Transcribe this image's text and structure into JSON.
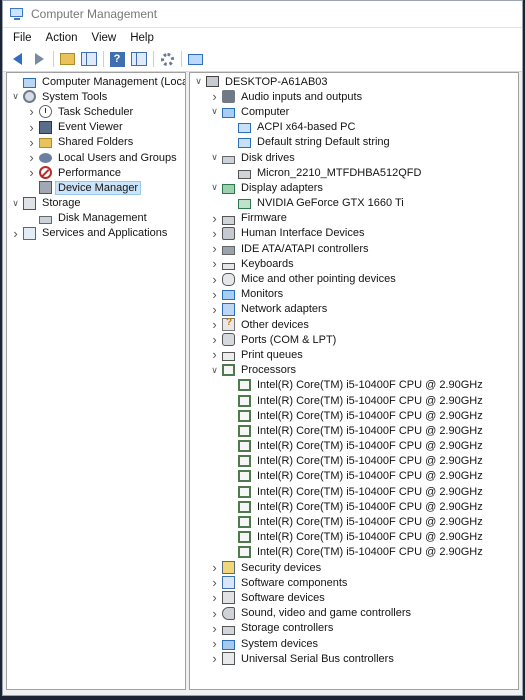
{
  "window": {
    "title": "Computer Management"
  },
  "menu": [
    "File",
    "Action",
    "View",
    "Help"
  ],
  "toolbar": {
    "buttons": [
      "back-icon",
      "forward-icon",
      "up-folder-icon",
      "show-hide-tree-icon",
      "help-icon",
      "show-pane-icon",
      "properties-icon",
      "monitor-icon"
    ]
  },
  "left_tree": [
    {
      "label": "Computer Management (Local)",
      "depth": 0,
      "expander": "none",
      "icon": "computer-management-icon"
    },
    {
      "label": "System Tools",
      "depth": 0,
      "expander": "open",
      "icon": "system-tools-icon"
    },
    {
      "label": "Task Scheduler",
      "depth": 1,
      "expander": "closed",
      "icon": "task-scheduler-icon"
    },
    {
      "label": "Event Viewer",
      "depth": 1,
      "expander": "closed",
      "icon": "event-viewer-icon"
    },
    {
      "label": "Shared Folders",
      "depth": 1,
      "expander": "closed",
      "icon": "shared-folders-icon"
    },
    {
      "label": "Local Users and Groups",
      "depth": 1,
      "expander": "closed",
      "icon": "local-users-icon"
    },
    {
      "label": "Performance",
      "depth": 1,
      "expander": "closed",
      "icon": "performance-icon"
    },
    {
      "label": "Device Manager",
      "depth": 1,
      "expander": "none",
      "icon": "device-manager-icon",
      "selected": true
    },
    {
      "label": "Storage",
      "depth": 0,
      "expander": "open",
      "icon": "storage-icon"
    },
    {
      "label": "Disk Management",
      "depth": 1,
      "expander": "none",
      "icon": "disk-management-icon"
    },
    {
      "label": "Services and Applications",
      "depth": 0,
      "expander": "closed",
      "icon": "services-applications-icon"
    }
  ],
  "device_tree": {
    "host": "DESKTOP-A61AB03",
    "items": [
      {
        "label": "Audio inputs and outputs",
        "depth": 1,
        "expander": "closed",
        "icon": "speaker-icon"
      },
      {
        "label": "Computer",
        "depth": 1,
        "expander": "open",
        "icon": "computer-icon"
      },
      {
        "label": "ACPI x64-based PC",
        "depth": 2,
        "expander": "none",
        "icon": "computer-small-icon"
      },
      {
        "label": "Default string Default string",
        "depth": 2,
        "expander": "none",
        "icon": "computer-small-icon"
      },
      {
        "label": "Disk drives",
        "depth": 1,
        "expander": "open",
        "icon": "disk-drive-icon"
      },
      {
        "label": "Micron_2210_MTFDHBA512QFD",
        "depth": 2,
        "expander": "none",
        "icon": "disk-chip-icon"
      },
      {
        "label": "Display adapters",
        "depth": 1,
        "expander": "open",
        "icon": "display-adapter-icon"
      },
      {
        "label": "NVIDIA GeForce GTX 1660 Ti",
        "depth": 2,
        "expander": "none",
        "icon": "graphics-card-icon"
      },
      {
        "label": "Firmware",
        "depth": 1,
        "expander": "closed",
        "icon": "firmware-icon"
      },
      {
        "label": "Human Interface Devices",
        "depth": 1,
        "expander": "closed",
        "icon": "hid-icon"
      },
      {
        "label": "IDE ATA/ATAPI controllers",
        "depth": 1,
        "expander": "closed",
        "icon": "ide-controller-icon"
      },
      {
        "label": "Keyboards",
        "depth": 1,
        "expander": "closed",
        "icon": "keyboard-icon"
      },
      {
        "label": "Mice and other pointing devices",
        "depth": 1,
        "expander": "closed",
        "icon": "mouse-icon"
      },
      {
        "label": "Monitors",
        "depth": 1,
        "expander": "closed",
        "icon": "monitor-icon"
      },
      {
        "label": "Network adapters",
        "depth": 1,
        "expander": "closed",
        "icon": "network-adapter-icon"
      },
      {
        "label": "Other devices",
        "depth": 1,
        "expander": "closed",
        "icon": "other-devices-icon"
      },
      {
        "label": "Ports (COM & LPT)",
        "depth": 1,
        "expander": "closed",
        "icon": "ports-icon"
      },
      {
        "label": "Print queues",
        "depth": 1,
        "expander": "closed",
        "icon": "printer-icon"
      },
      {
        "label": "Processors",
        "depth": 1,
        "expander": "open",
        "icon": "processor-icon"
      },
      {
        "label": "Intel(R) Core(TM) i5-10400F CPU @ 2.90GHz",
        "depth": 2,
        "expander": "none",
        "icon": "processor-icon"
      },
      {
        "label": "Intel(R) Core(TM) i5-10400F CPU @ 2.90GHz",
        "depth": 2,
        "expander": "none",
        "icon": "processor-icon"
      },
      {
        "label": "Intel(R) Core(TM) i5-10400F CPU @ 2.90GHz",
        "depth": 2,
        "expander": "none",
        "icon": "processor-icon"
      },
      {
        "label": "Intel(R) Core(TM) i5-10400F CPU @ 2.90GHz",
        "depth": 2,
        "expander": "none",
        "icon": "processor-icon"
      },
      {
        "label": "Intel(R) Core(TM) i5-10400F CPU @ 2.90GHz",
        "depth": 2,
        "expander": "none",
        "icon": "processor-icon"
      },
      {
        "label": "Intel(R) Core(TM) i5-10400F CPU @ 2.90GHz",
        "depth": 2,
        "expander": "none",
        "icon": "processor-icon"
      },
      {
        "label": "Intel(R) Core(TM) i5-10400F CPU @ 2.90GHz",
        "depth": 2,
        "expander": "none",
        "icon": "processor-icon"
      },
      {
        "label": "Intel(R) Core(TM) i5-10400F CPU @ 2.90GHz",
        "depth": 2,
        "expander": "none",
        "icon": "processor-icon"
      },
      {
        "label": "Intel(R) Core(TM) i5-10400F CPU @ 2.90GHz",
        "depth": 2,
        "expander": "none",
        "icon": "processor-icon"
      },
      {
        "label": "Intel(R) Core(TM) i5-10400F CPU @ 2.90GHz",
        "depth": 2,
        "expander": "none",
        "icon": "processor-icon"
      },
      {
        "label": "Intel(R) Core(TM) i5-10400F CPU @ 2.90GHz",
        "depth": 2,
        "expander": "none",
        "icon": "processor-icon"
      },
      {
        "label": "Intel(R) Core(TM) i5-10400F CPU @ 2.90GHz",
        "depth": 2,
        "expander": "none",
        "icon": "processor-icon"
      },
      {
        "label": "Security devices",
        "depth": 1,
        "expander": "closed",
        "icon": "security-device-icon"
      },
      {
        "label": "Software components",
        "depth": 1,
        "expander": "closed",
        "icon": "software-component-icon"
      },
      {
        "label": "Software devices",
        "depth": 1,
        "expander": "closed",
        "icon": "software-device-icon"
      },
      {
        "label": "Sound, video and game controllers",
        "depth": 1,
        "expander": "closed",
        "icon": "sound-controller-icon"
      },
      {
        "label": "Storage controllers",
        "depth": 1,
        "expander": "closed",
        "icon": "storage-controller-icon"
      },
      {
        "label": "System devices",
        "depth": 1,
        "expander": "closed",
        "icon": "system-devices-icon"
      },
      {
        "label": "Universal Serial Bus controllers",
        "depth": 1,
        "expander": "closed",
        "icon": "usb-icon"
      }
    ]
  },
  "colors": {
    "selection": "#cce4f7",
    "selection_border": "#99c9ef",
    "accent": "#2a6fb8"
  }
}
